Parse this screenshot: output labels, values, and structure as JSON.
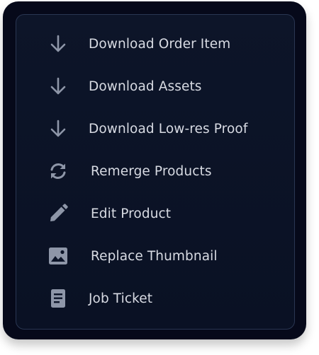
{
  "menu": {
    "items": [
      {
        "icon": "arrow-down-icon",
        "label": "Download Order Item"
      },
      {
        "icon": "arrow-down-icon",
        "label": "Download Assets"
      },
      {
        "icon": "arrow-down-icon",
        "label": "Download Low-res Proof"
      },
      {
        "icon": "refresh-icon",
        "label": "Remerge Products"
      },
      {
        "icon": "pencil-icon",
        "label": "Edit Product"
      },
      {
        "icon": "image-icon",
        "label": "Replace Thumbnail"
      },
      {
        "icon": "document-icon",
        "label": "Job Ticket"
      }
    ]
  },
  "colors": {
    "frame": "#06091a",
    "panel": "#0d1529",
    "panel_border": "#2a3652",
    "text": "#d8dbe3",
    "icon": "#8e96a8"
  }
}
